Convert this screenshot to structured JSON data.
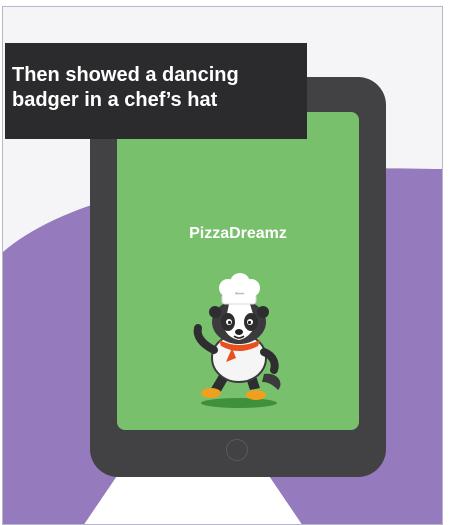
{
  "caption": {
    "text": "Then showed a dancing badger in a chef’s hat"
  },
  "app": {
    "title": "PizzaDreamz"
  },
  "colors": {
    "purple": "#957bbd",
    "tablet": "#424245",
    "screen": "#79c06d",
    "caption_bg": "#2b2b2d"
  },
  "icons": {
    "mascot": "badger-chef-icon",
    "home": "home-button-icon"
  }
}
